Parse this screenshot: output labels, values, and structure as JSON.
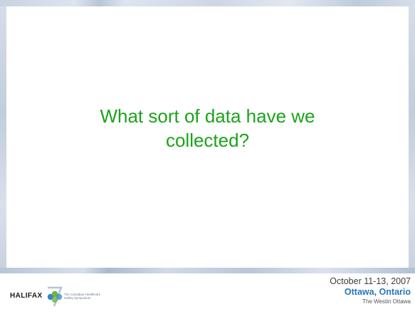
{
  "slide": {
    "title_lines": [
      "What sort of data have we",
      "collected?"
    ]
  },
  "footer": {
    "logo": {
      "wordmark": "HALIFAX",
      "mark_icon": "halifax-7-logo-icon",
      "tagline_lines": [
        "The Canadian Healthcare",
        "Safety Symposium"
      ]
    },
    "event": {
      "date": "October 11-13, 2007",
      "city": "Ottawa, Ontario",
      "venue": "The Westin Ottawa"
    }
  },
  "colors": {
    "title": "#1aa31a",
    "city": "#2a76b8",
    "border": "#c9d3e1"
  }
}
